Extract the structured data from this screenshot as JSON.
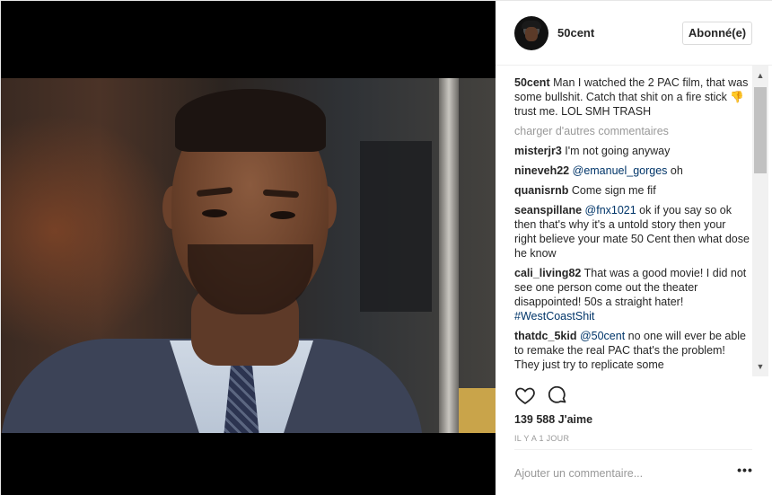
{
  "header": {
    "username": "50cent",
    "follow_label": "Abonné(e)"
  },
  "caption": {
    "username": "50cent",
    "text_before_emoji": "Man I watched the 2 PAC film, that was some bullshit. Catch that shit on a fire stick",
    "emoji": "👎",
    "text_after_emoji": "trust me. LOL SMH TRASH"
  },
  "load_more_label": "charger d'autres commentaires",
  "comments": [
    {
      "username": "misterjr3",
      "text": "I'm not going anyway"
    },
    {
      "username": "nineveh22",
      "mention": "@emanuel_gorges",
      "text": " oh"
    },
    {
      "username": "quanisrnb",
      "text": "Come sign me fif"
    },
    {
      "username": "seanspillane",
      "mention": "@fnx1021",
      "text": " ok if you say so ok then that's why it's a untold story then your right believe your mate 50 Cent then what dose he know"
    },
    {
      "username": "cali_living82",
      "text": "That was a good movie! I did not see one person come out the theater disappointed! 50s a straight hater! ",
      "hashtag": "#WestCoastShit"
    },
    {
      "username": "thatdc_5kid",
      "mention": "@50cent",
      "text": " no one will ever be able to remake the real PAC that's the problem! They just try to replicate some"
    }
  ],
  "actions": {
    "like_icon": "heart-icon",
    "comment_icon": "comment-bubble-icon"
  },
  "likes_text": "139 588 J'aime",
  "timestamp": "IL Y A 1 JOUR",
  "add_comment_placeholder": "Ajouter un commentaire...",
  "more_label": "•••",
  "scrollbar": {
    "up_arrow": "▲",
    "down_arrow": "▼"
  },
  "colors": {
    "link": "#003569",
    "muted": "#999999",
    "text": "#262626",
    "border": "#dbdbdb"
  }
}
